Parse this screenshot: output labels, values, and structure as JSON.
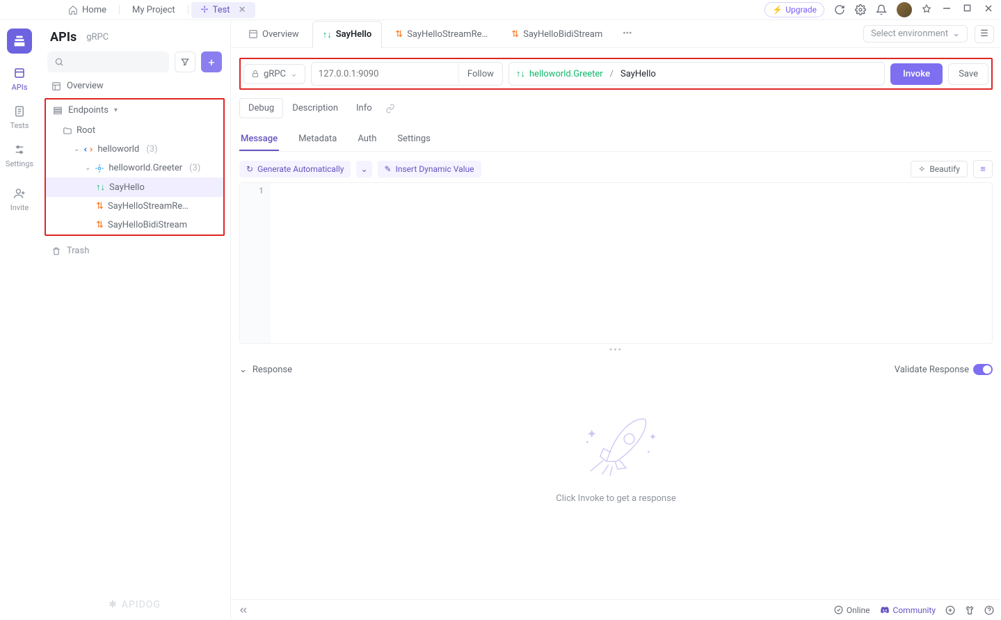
{
  "titlebar": {
    "home": "Home",
    "project": "My Project",
    "activeTab": "Test"
  },
  "upgrade_label": "Upgrade",
  "rail": {
    "items": [
      {
        "label": "APIs",
        "icon": "apis-icon",
        "active": true
      },
      {
        "label": "Tests",
        "icon": "tests-icon"
      },
      {
        "label": "Settings",
        "icon": "settings-icon"
      }
    ],
    "invite": "Invite"
  },
  "leftpanel": {
    "title": "APIs",
    "subtitle": "gRPC",
    "overview": "Overview",
    "endpoints": "Endpoints",
    "root": "Root",
    "hello": "helloworld",
    "hello_count": "(3)",
    "greeter": "helloworld.Greeter",
    "greeter_count": "(3)",
    "m1": "SayHello",
    "m2": "SayHelloStreamRe…",
    "m3": "SayHelloBidiStream",
    "trash": "Trash",
    "brand": "APIDOG"
  },
  "tabs": {
    "overview": "Overview",
    "t1": "SayHello",
    "t2": "SayHelloStreamRe…",
    "t3": "SayHelloBidiStream",
    "env": "Select environment"
  },
  "reqbar": {
    "proto": "gRPC",
    "url_placeholder": "127.0.0.1:9090",
    "follow": "Follow",
    "service": "helloworld.Greeter",
    "method": "SayHello",
    "invoke": "Invoke",
    "save": "Save"
  },
  "pills": {
    "debug": "Debug",
    "description": "Description",
    "info": "Info"
  },
  "subtabs": {
    "message": "Message",
    "metadata": "Metadata",
    "auth": "Auth",
    "settings": "Settings"
  },
  "edbar": {
    "generate": "Generate Automatically",
    "insert": "Insert Dynamic Value",
    "beautify": "Beautify"
  },
  "editor": {
    "line1": "1"
  },
  "response": {
    "title": "Response",
    "validate": "Validate Response",
    "empty": "Click Invoke to get a response"
  },
  "statusbar": {
    "online": "Online",
    "community": "Community"
  }
}
